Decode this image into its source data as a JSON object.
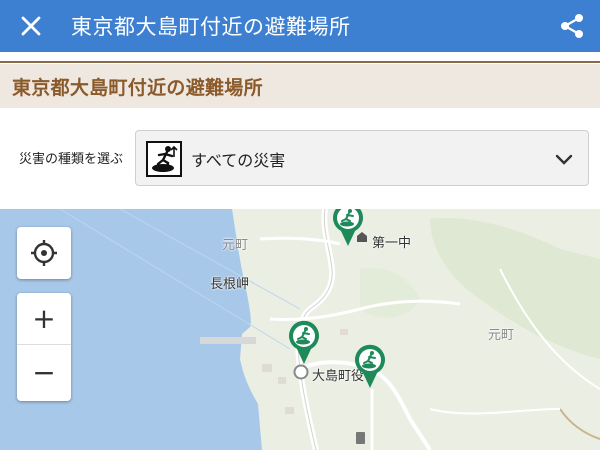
{
  "header": {
    "title": "東京都大島町付近の避難場所"
  },
  "section": {
    "heading": "東京都大島町付近の避難場所"
  },
  "filter": {
    "label": "災害の種類を選ぶ",
    "selected": "すべての災害"
  },
  "map": {
    "labels": {
      "motomachi_left": "元町",
      "motomachi_right": "元町",
      "nagane_misaki": "長根岬",
      "daiichi_chu": "第一中",
      "oshima_town": "大島町役"
    },
    "controls": {
      "locate": "crosshair-icon",
      "zoom_in": "+",
      "zoom_out": "−"
    }
  },
  "colors": {
    "appbar": "#3d7fd0",
    "section_bg": "#efe8e1",
    "section_text": "#8b5a2b",
    "pin_green": "#1e8a5a",
    "sea": "#a8c8ea",
    "land": "#eaeee3"
  }
}
